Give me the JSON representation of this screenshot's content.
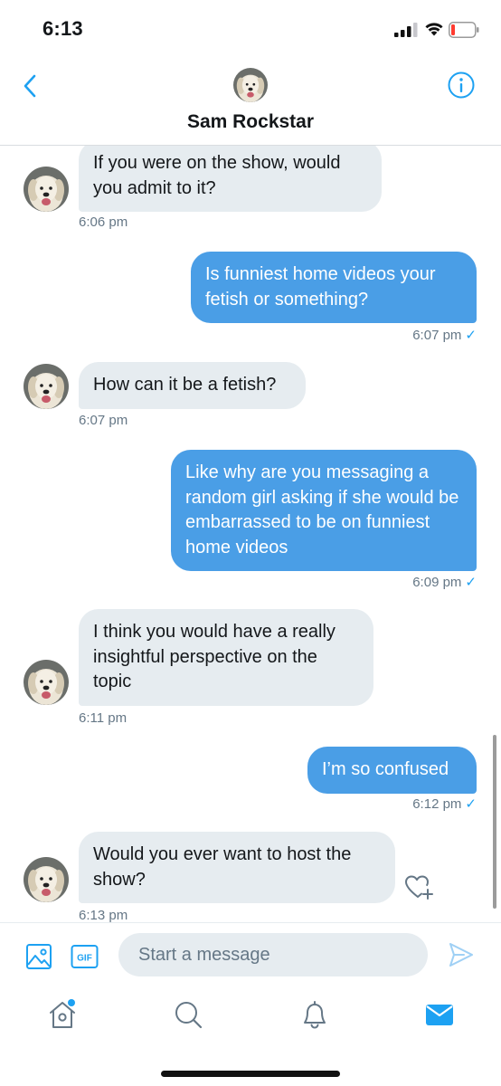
{
  "status_bar": {
    "time": "6:13"
  },
  "header": {
    "name": "Sam Rockstar"
  },
  "messages": [
    {
      "direction": "in",
      "text": "If you were on the show, would you admit to it?",
      "time": "6:06 pm"
    },
    {
      "direction": "out",
      "text": "Is funniest home videos your fetish or something?",
      "time": "6:07 pm"
    },
    {
      "direction": "in",
      "text": "How can it be a fetish?",
      "time": "6:07 pm"
    },
    {
      "direction": "out",
      "text": "Like why are you messaging a random girl asking if she would be embarrassed to be on funniest home videos",
      "time": "6:09 pm"
    },
    {
      "direction": "in",
      "text": "I think you would have a really insightful perspective on the topic",
      "time": "6:11 pm"
    },
    {
      "direction": "out",
      "text": "I’m so confused",
      "time": "6:12 pm"
    },
    {
      "direction": "in",
      "text": "Would you ever want to host the show?",
      "time": "6:13 pm"
    }
  ],
  "composer": {
    "placeholder": "Start a message",
    "gif_label": "GIF"
  },
  "icons": {
    "back": "chevron-left-icon",
    "info": "info-icon",
    "media": "image-icon",
    "gif": "gif-icon",
    "send": "send-icon",
    "like": "heart-plus-icon",
    "home": "home-icon",
    "search": "search-icon",
    "notifications": "bell-icon",
    "messages": "mail-icon"
  },
  "colors": {
    "accent": "#1da1f2",
    "outgoing_bubble": "#4a9ee6",
    "incoming_bubble": "#e6ecf0",
    "time_text": "#657786"
  }
}
